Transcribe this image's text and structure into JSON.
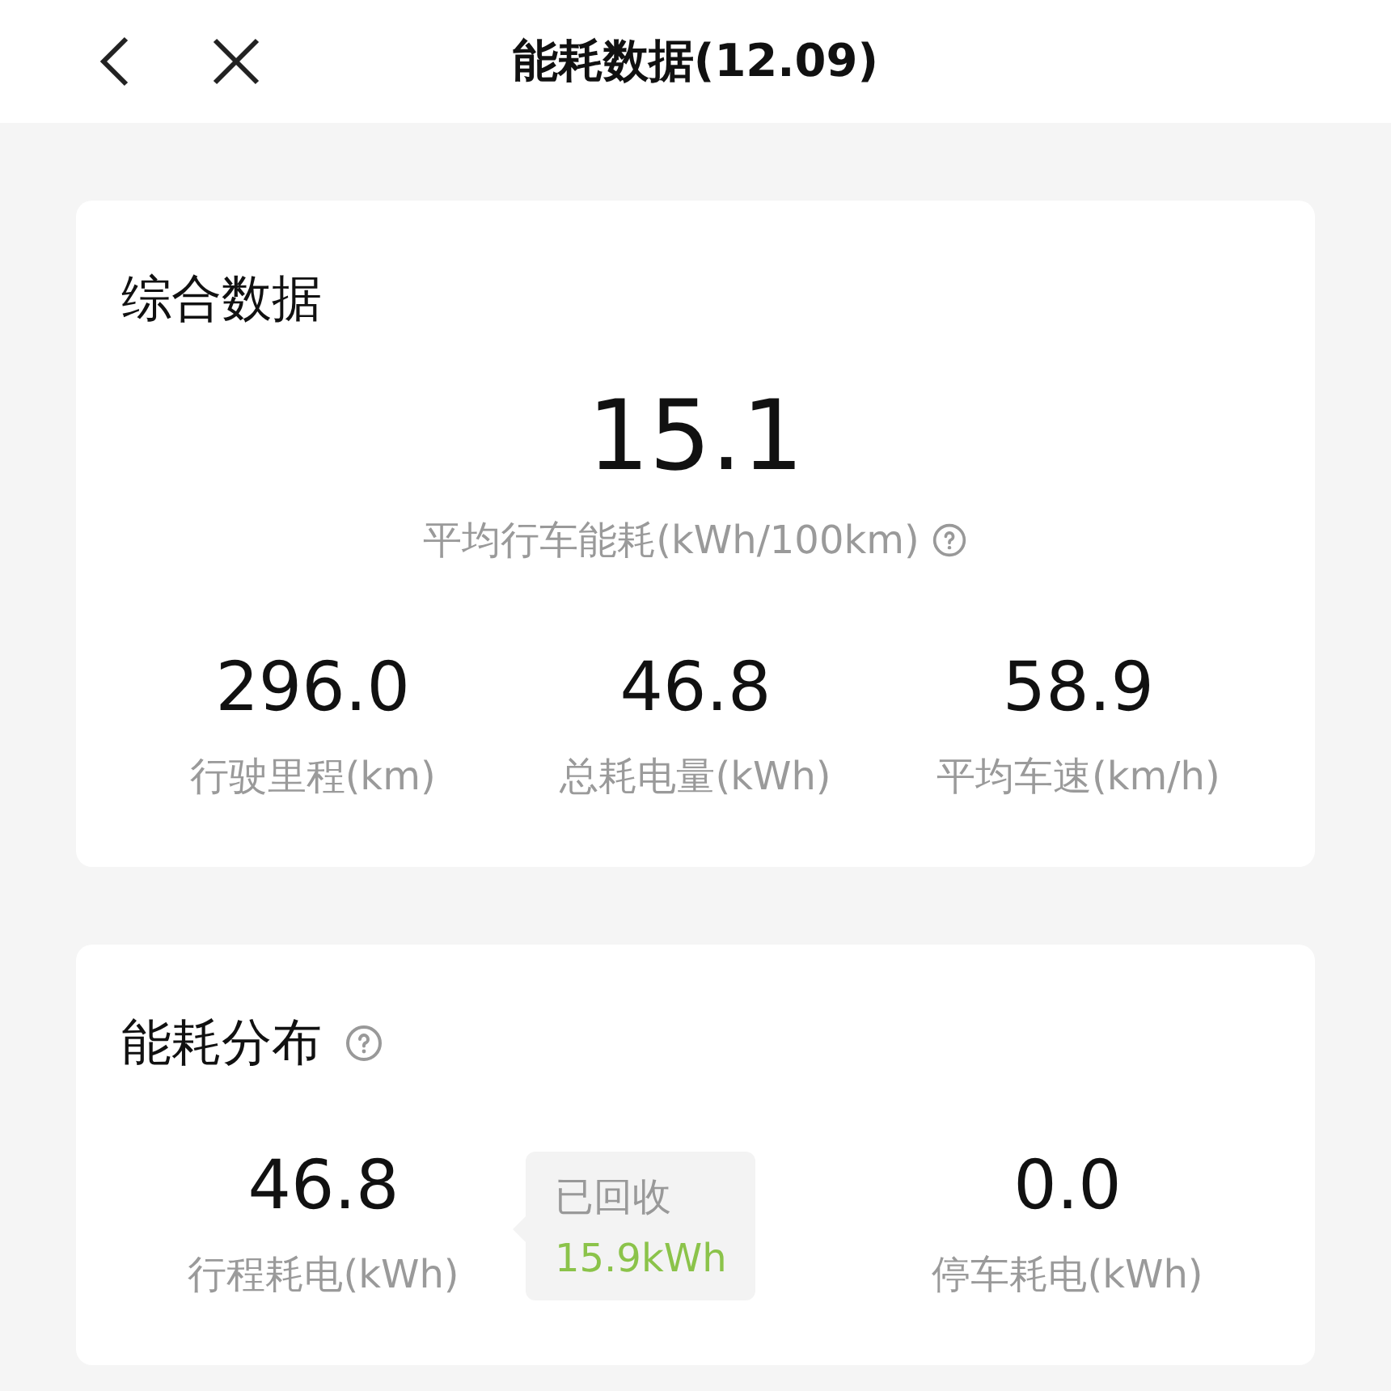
{
  "header": {
    "title": "能耗数据(12.09)"
  },
  "summary": {
    "title": "综合数据",
    "main": {
      "value": "15.1",
      "label": "平均行车能耗(kWh/100km)"
    },
    "stats": [
      {
        "value": "296.0",
        "label": "行驶里程(km)"
      },
      {
        "value": "46.8",
        "label": "总耗电量(kWh)"
      },
      {
        "value": "58.9",
        "label": "平均车速(km/h)"
      }
    ]
  },
  "distribution": {
    "title": "能耗分布",
    "driving": {
      "value": "46.8",
      "label": "行程耗电(kWh)"
    },
    "recovered": {
      "label": "已回收",
      "value": "15.9kWh"
    },
    "parked": {
      "value": "0.0",
      "label": "停车耗电(kWh)"
    }
  }
}
